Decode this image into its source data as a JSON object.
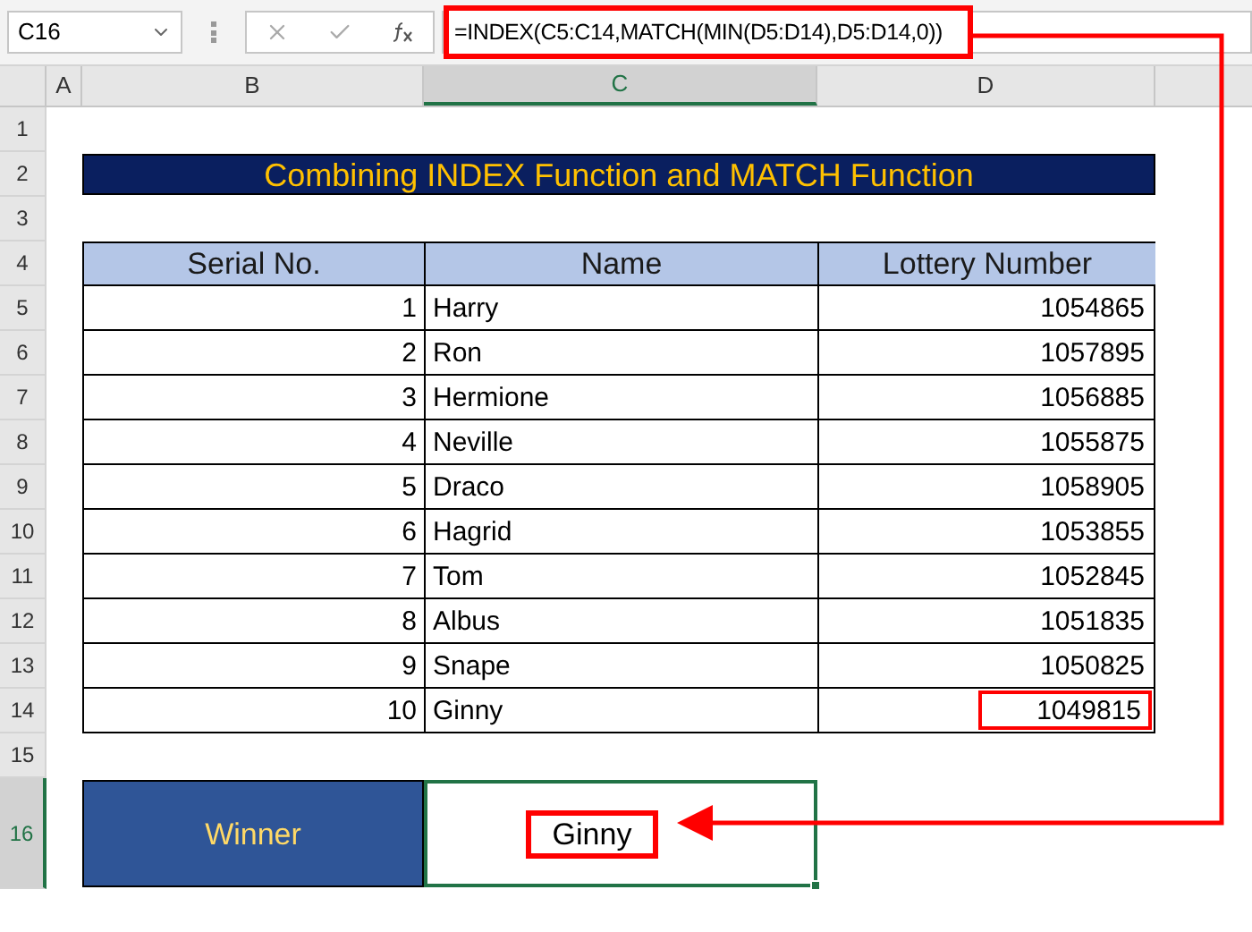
{
  "name_box": "C16",
  "formula": "=INDEX(C5:C14,MATCH(MIN(D5:D14),D5:D14,0))",
  "column_headers": [
    {
      "label": "A",
      "selected": false
    },
    {
      "label": "B",
      "selected": false
    },
    {
      "label": "C",
      "selected": true
    },
    {
      "label": "D",
      "selected": false
    }
  ],
  "row_headers": [
    {
      "label": "1",
      "selected": false
    },
    {
      "label": "2",
      "selected": false
    },
    {
      "label": "3",
      "selected": false
    },
    {
      "label": "4",
      "selected": false
    },
    {
      "label": "5",
      "selected": false
    },
    {
      "label": "6",
      "selected": false
    },
    {
      "label": "7",
      "selected": false
    },
    {
      "label": "8",
      "selected": false
    },
    {
      "label": "9",
      "selected": false
    },
    {
      "label": "10",
      "selected": false
    },
    {
      "label": "11",
      "selected": false
    },
    {
      "label": "12",
      "selected": false
    },
    {
      "label": "13",
      "selected": false
    },
    {
      "label": "14",
      "selected": false
    },
    {
      "label": "15",
      "selected": false
    },
    {
      "label": "16",
      "selected": true
    }
  ],
  "title": "Combining INDEX Function and MATCH Function",
  "table": {
    "columns": [
      "Serial No.",
      "Name",
      "Lottery Number"
    ],
    "rows": [
      {
        "serial": "1",
        "name": "Harry",
        "number": "1054865",
        "highlighted": false
      },
      {
        "serial": "2",
        "name": "Ron",
        "number": "1057895",
        "highlighted": false
      },
      {
        "serial": "3",
        "name": "Hermione",
        "number": "1056885",
        "highlighted": false
      },
      {
        "serial": "4",
        "name": "Neville",
        "number": "1055875",
        "highlighted": false
      },
      {
        "serial": "5",
        "name": "Draco",
        "number": "1058905",
        "highlighted": false
      },
      {
        "serial": "6",
        "name": "Hagrid",
        "number": "1053855",
        "highlighted": false
      },
      {
        "serial": "7",
        "name": "Tom",
        "number": "1052845",
        "highlighted": false
      },
      {
        "serial": "8",
        "name": "Albus",
        "number": "1051835",
        "highlighted": false
      },
      {
        "serial": "9",
        "name": "Snape",
        "number": "1050825",
        "highlighted": false
      },
      {
        "serial": "10",
        "name": "Ginny",
        "number": "1049815",
        "highlighted": true
      }
    ]
  },
  "winner": {
    "label": "Winner",
    "value": "Ginny"
  }
}
